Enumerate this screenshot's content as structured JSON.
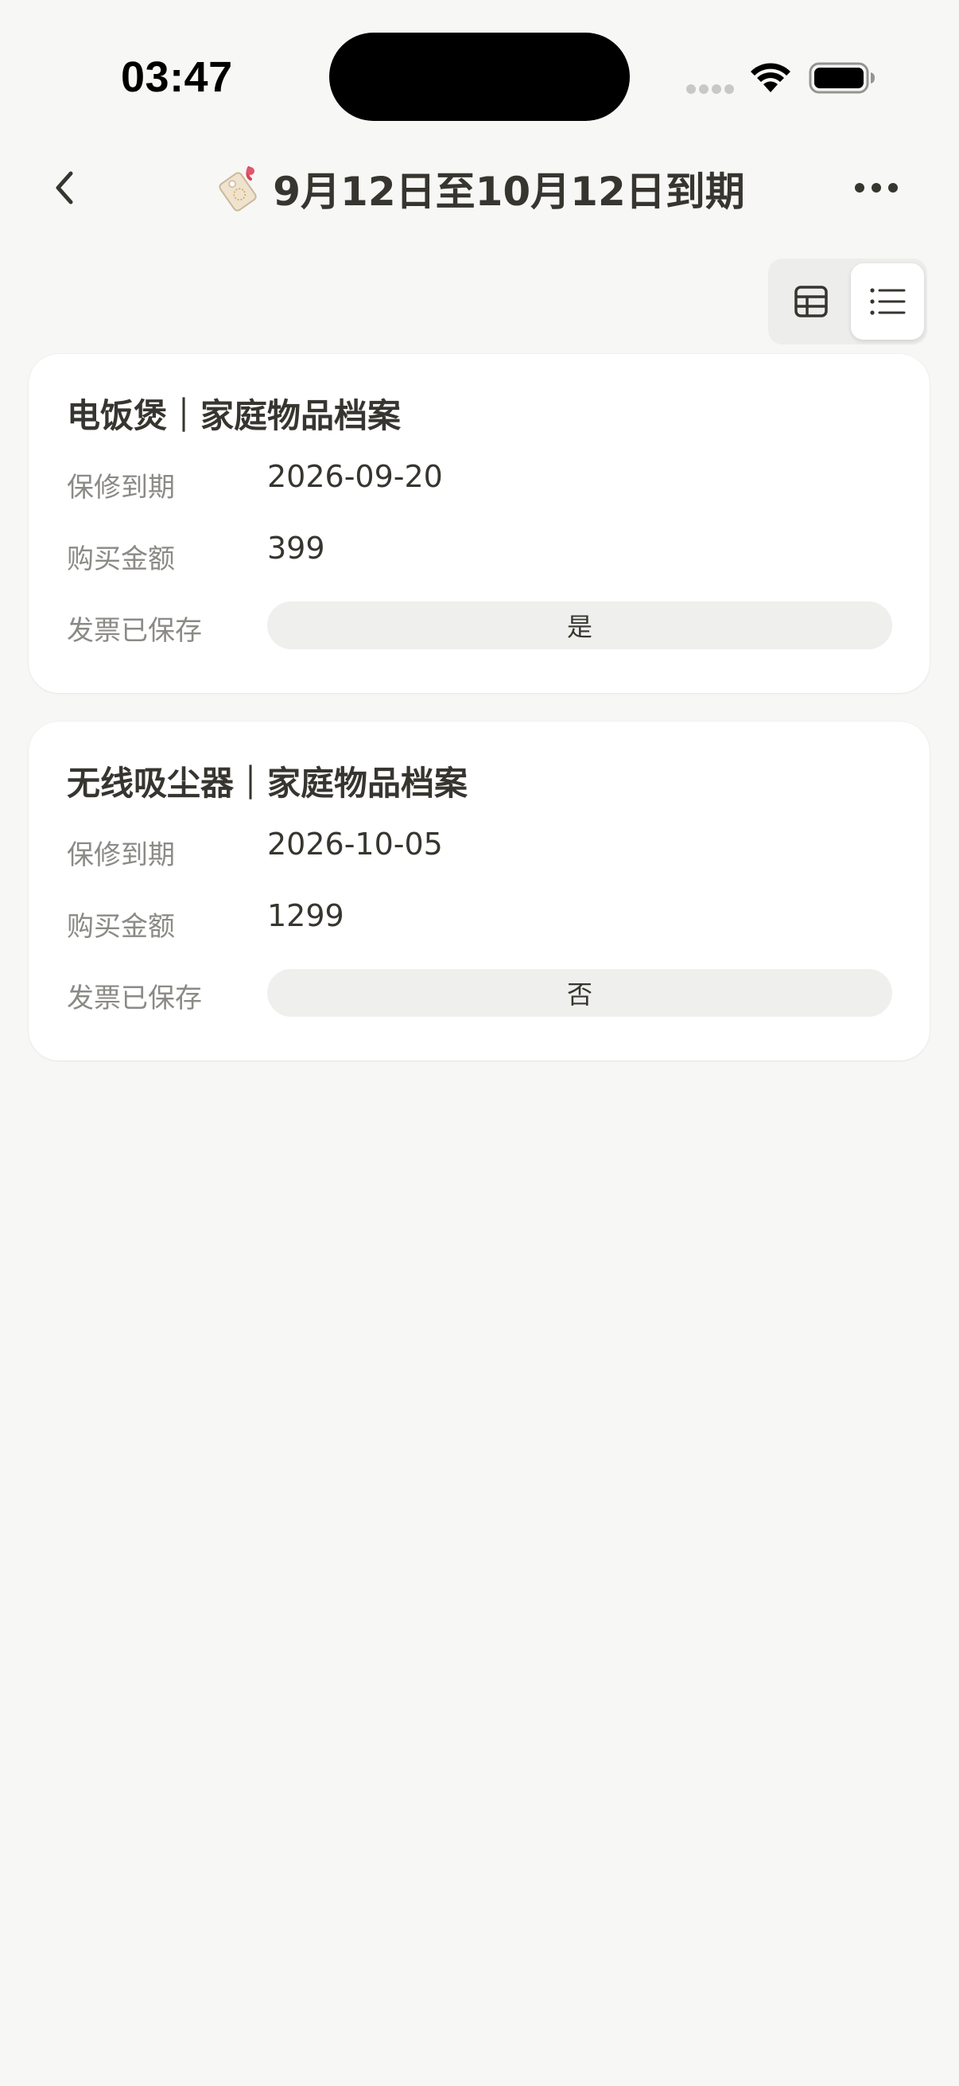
{
  "status_bar": {
    "time": "03:47"
  },
  "header": {
    "title": "9月12日至10月12日到期",
    "emoji_icon": "tag-icon"
  },
  "view_toggle": {
    "options": [
      "table-view-icon",
      "list-view-icon"
    ],
    "selected": "list-view-icon"
  },
  "cards": [
    {
      "title": "电饭煲｜家庭物品档案",
      "properties": [
        {
          "label": "保修到期",
          "value": "2026-09-20"
        },
        {
          "label": "购买金额",
          "value": "399"
        },
        {
          "label": "发票已保存",
          "value": "是"
        }
      ]
    },
    {
      "title": "无线吸尘器｜家庭物品档案",
      "properties": [
        {
          "label": "保修到期",
          "value": "2026-10-05"
        },
        {
          "label": "购买金额",
          "value": "1299"
        },
        {
          "label": "发票已保存",
          "value": "否"
        }
      ]
    }
  ],
  "colors": {
    "background": "#f7f7f5",
    "card": "#ffffff",
    "text": "#37352f",
    "label": "#8b8a86",
    "pill": "#efefed"
  }
}
